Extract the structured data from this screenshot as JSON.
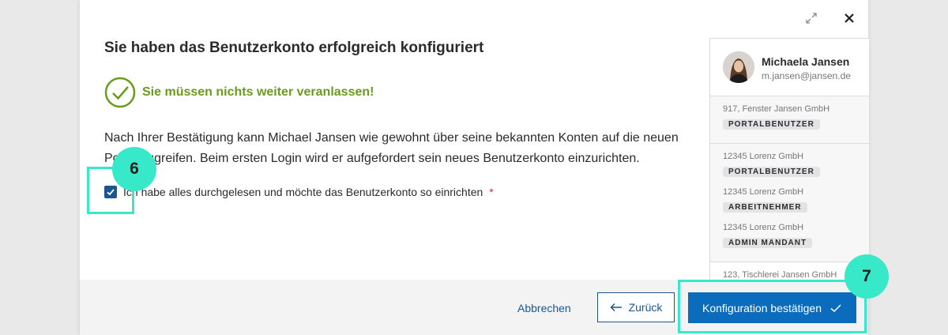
{
  "dialog": {
    "title": "Sie haben das Benutzerkonto erfolgreich konfiguriert",
    "success_message": "Sie müssen nichts weiter veranlassen!",
    "body": "Nach Ihrer Bestätigung kann Michael Jansen wie gewohnt über seine bekannten Konten auf die neuen Portal zugreifen. Beim ersten Login wird er aufgefordert sein neues Benutzerkonto einzurichten.",
    "checkbox_label": "Ich habe alles durchgelesen und möchte das Benutzerkonto so einrichten",
    "required_marker": "*",
    "checkbox_checked": true
  },
  "profile": {
    "name": "Michaela Jansen",
    "email": "m.jansen@jansen.de"
  },
  "accounts": [
    {
      "company": "917, Fenster Jansen GmbH",
      "roles": [
        "PORTALBENUTZER"
      ]
    },
    {
      "company": "12345 Lorenz GmbH",
      "roles": [
        "PORTALBENUTZER",
        "ARBEITNEHMER",
        "ADMIN MANDANT"
      ],
      "companies": [
        "12345 Lorenz GmbH",
        "12345 Lorenz GmbH",
        "12345 Lorenz GmbH"
      ]
    },
    {
      "company": "123, Tischlerei Jansen GmbH",
      "roles": []
    }
  ],
  "footer": {
    "cancel_label": "Abbrechen",
    "back_label": "Zurück",
    "confirm_label": "Konfiguration bestätigen"
  },
  "annotations": {
    "step_checkbox": "6",
    "step_confirm": "7"
  },
  "colors": {
    "accent": "#0b6cbd",
    "success": "#6b9b1e",
    "highlight": "#37e8c9",
    "required": "#d0312d"
  }
}
